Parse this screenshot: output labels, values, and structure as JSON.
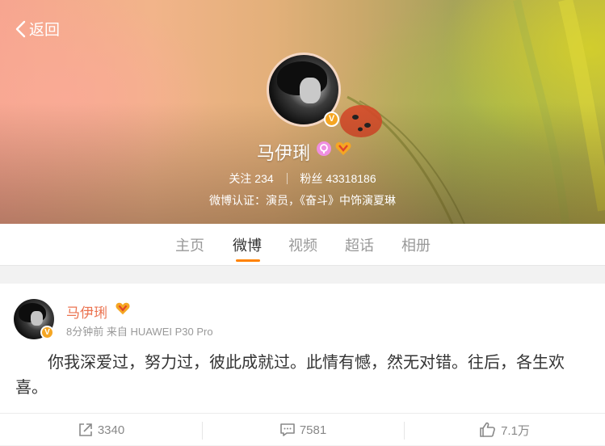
{
  "nav": {
    "back_label": "返回"
  },
  "profile": {
    "name": "马伊琍",
    "following_label": "关注",
    "following_count": "234",
    "followers_label": "粉丝",
    "followers_count": "43318186",
    "verification": "微博认证：演员，《奋斗》中饰演夏琳"
  },
  "tabs": [
    {
      "label": "主页",
      "active": false
    },
    {
      "label": "微博",
      "active": true
    },
    {
      "label": "视频",
      "active": false
    },
    {
      "label": "超话",
      "active": false
    },
    {
      "label": "相册",
      "active": false
    }
  ],
  "post": {
    "author": "马伊琍",
    "meta": "8分钟前 来自 HUAWEI P30 Pro",
    "text": "你我深爱过，努力过，彼此成就过。此情有憾，然无对错。往后，各生欢喜。",
    "reposts": "3340",
    "comments": "7581",
    "likes": "7.1万"
  },
  "colors": {
    "accent": "#ff8200",
    "author_name": "#eb7350",
    "verified_badge": "#f5a623"
  },
  "icons": {
    "back": "chevron-left-icon",
    "verified": "verified-v-icon",
    "vip": "vip-icon",
    "member": "member-heart-icon",
    "repost": "share-icon",
    "comment": "comment-icon",
    "like": "thumbs-up-icon"
  }
}
